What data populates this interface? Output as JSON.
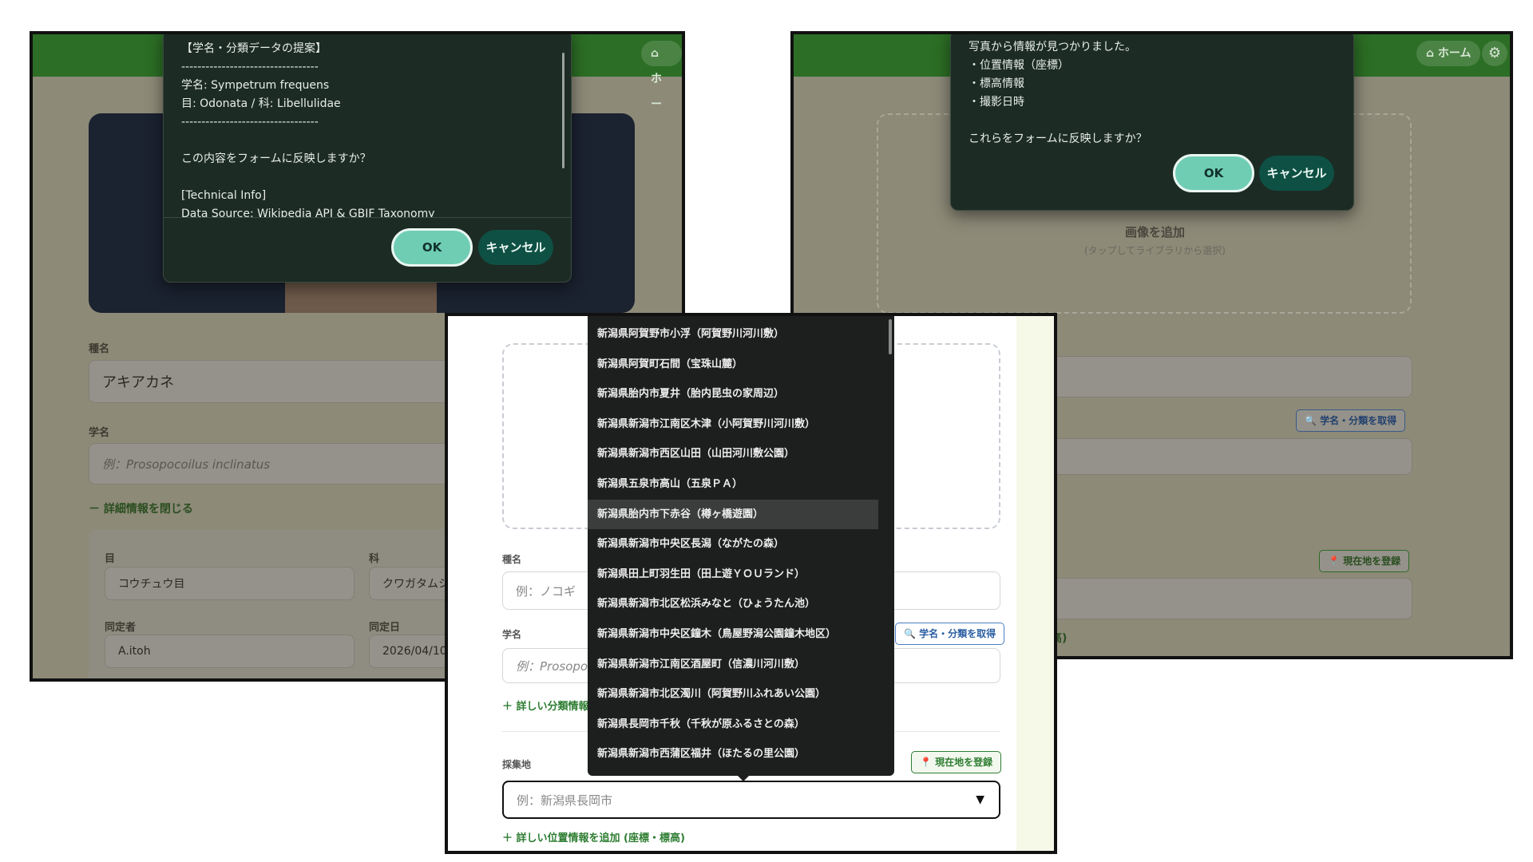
{
  "left": {
    "home_label": "⌂ ホー",
    "dialog": {
      "lines": "【学名・分類データの提案】\n----------------------------------\n学名: Sympetrum frequens\n目: Odonata / 科: Libellulidae\n----------------------------------\n\nこの内容をフォームに反映しますか？\n\n[Technical Info]\nData Source: Wikipedia API & GBIF Taxonomy",
      "ok": "OK",
      "cancel": "キャンセル"
    },
    "species_label": "種名",
    "species_value": "アキアカネ",
    "sci_label": "学名",
    "sci_placeholder": "例：Prosopocoilus inclinatus",
    "close_details": "－ 詳細情報を閉じる",
    "order_label": "目",
    "order_value": "コウチュウ目",
    "family_label": "科",
    "family_value": "クワガタムシ",
    "identifier_label": "同定者",
    "identifier_value": "A.itoh",
    "id_date_label": "同定日",
    "id_date_value": "2026/04/10"
  },
  "right": {
    "home_label": "⌂ ホーム",
    "dialog": {
      "lines": "写真から情報が見つかりました。\n・位置情報（座標）\n・標高情報\n・撮影日時\n\nこれらをフォームに反映しますか？",
      "ok": "OK",
      "cancel": "キャンセル"
    },
    "add_image": "画像を追加",
    "add_image_hint": "(タップしてライブラリから選択)",
    "fetch_taxonomy": "🔍 学名・分類を取得",
    "register_location": "📍 現在地を登録",
    "paren": ")",
    "elevation_suffix": "高)"
  },
  "mid": {
    "dropdown_items": [
      "新潟県阿賀野市小浮（阿賀野川河川敷）",
      "新潟県阿賀町石間（宝珠山麓）",
      "新潟県胎内市夏井（胎内昆虫の家周辺）",
      "新潟県新潟市江南区木津（小阿賀野川河川敷）",
      "新潟県新潟市西区山田（山田河川敷公園）",
      "新潟県五泉市高山（五泉ＰＡ）",
      "新潟県胎内市下赤谷（樽ヶ橋遊園）",
      "新潟県新潟市中央区長潟（ながたの森）",
      "新潟県田上町羽生田（田上遊ＹＯＵランド）",
      "新潟県新潟市北区松浜みなと（ひょうたん池）",
      "新潟県新潟市中央区鐘木（鳥屋野潟公園鐘木地区）",
      "新潟県新潟市江南区酒屋町（信濃川河川敷）",
      "新潟県新潟市北区濁川（阿賀野川ふれあい公園）",
      "新潟県長岡市千秋（千秋が原ふるさとの森）",
      "新潟県新潟市西蒲区福井（ほたるの里公園）"
    ],
    "species_label": "種名",
    "species_placeholder": "例：ノコギ",
    "sci_label": "学名",
    "sci_placeholder": "例：Prosopo",
    "fetch_taxonomy": "🔍 学名・分類を取得",
    "detail_taxonomy": "＋ 詳しい分類情報",
    "location_label": "採集地",
    "register_location": "📍 現在地を登録",
    "location_placeholder": "例：新潟県長岡市",
    "caret": "▼",
    "add_location_detail": "＋ 詳しい位置情報を追加 (座標・標高)"
  }
}
